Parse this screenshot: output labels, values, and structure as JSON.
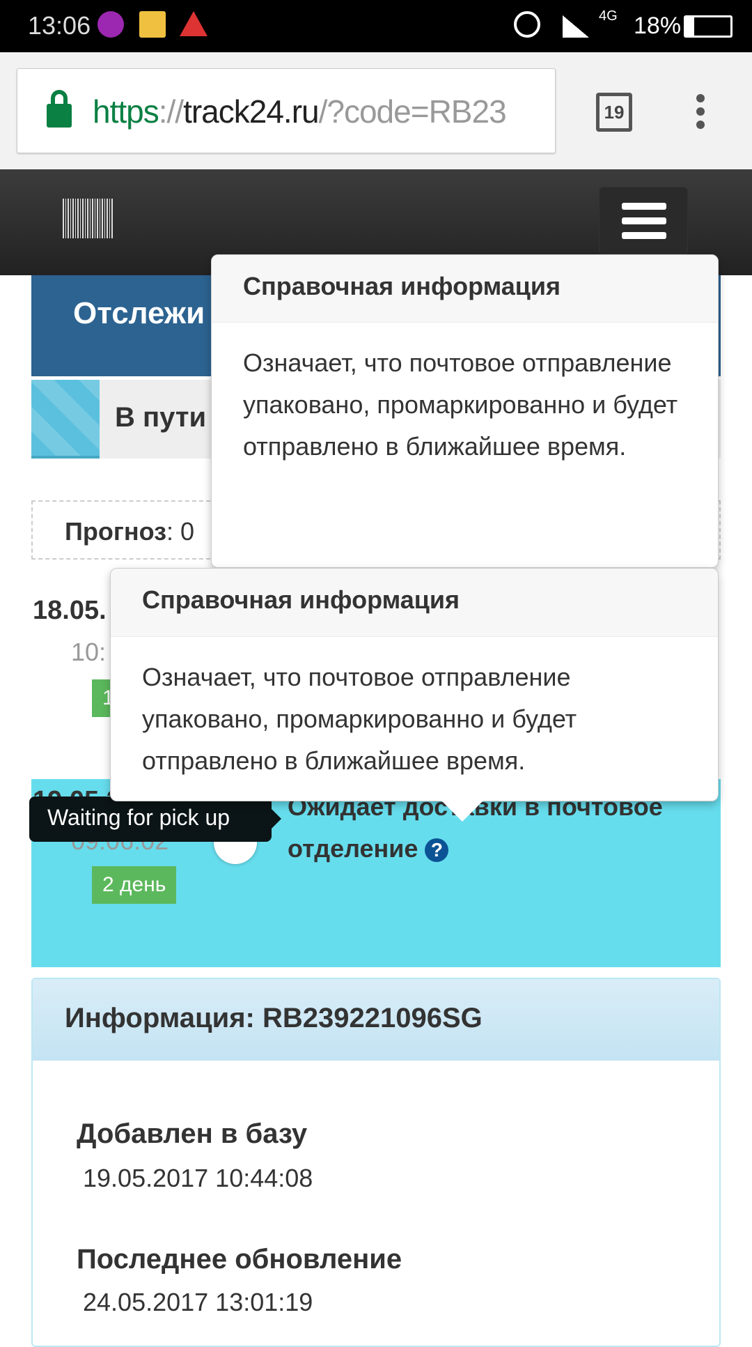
{
  "status_bar": {
    "time": "13:06",
    "battery": "18%",
    "network": "4G",
    "notif_icons": [
      "lollipop-icon",
      "mail-icon",
      "warning-icon"
    ]
  },
  "browser": {
    "url_scheme": "https",
    "url_sep": "://",
    "url_host": "track24.ru",
    "url_rest": "/?code=RB23",
    "tab_count": "19"
  },
  "colors": {
    "header": "#2c6391",
    "active_event": "#66dded",
    "badge": "#5cb85c",
    "help": "#0b5394"
  },
  "page": {
    "header_title": "Отслежи",
    "status": "В пути",
    "forecast_label": "Прогноз",
    "forecast_value": ": 0",
    "events": [
      {
        "date": "18.05.",
        "time": "10:",
        "badge": "1"
      },
      {
        "date": "19.05.2017",
        "time": "09:06:02",
        "badge": "2 день",
        "title": "Ожидает доставки в почтовое отделение",
        "tooltip": "Waiting for pick up"
      }
    ]
  },
  "popovers": [
    {
      "title": "Справочная информация",
      "body": "Означает, что почтовое отправление упаковано, промаркированно и будет отправлено в ближайшее время."
    },
    {
      "title": "Справочная информация",
      "body": "Означает, что почтовое отправление упаковано, промаркированно и будет отправлено в ближайшее время."
    }
  ],
  "info": {
    "title": "Информация: RB239221096SG",
    "added_label": "Добавлен в базу",
    "added_value": "19.05.2017 10:44:08",
    "updated_label": "Последнее обновление",
    "updated_value": "24.05.2017 13:01:19"
  }
}
